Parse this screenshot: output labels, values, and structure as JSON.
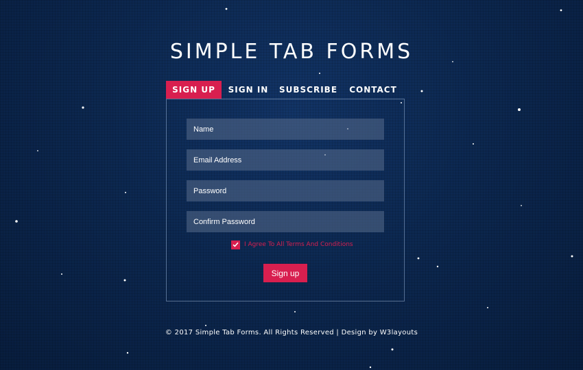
{
  "page": {
    "title": "SIMPLE TAB FORMS"
  },
  "tabs": [
    {
      "label": "SIGN UP",
      "active": true
    },
    {
      "label": "SIGN IN",
      "active": false
    },
    {
      "label": "SUBSCRIBE",
      "active": false
    },
    {
      "label": "CONTACT",
      "active": false
    }
  ],
  "form": {
    "fields": [
      {
        "placeholder": "Name",
        "value": ""
      },
      {
        "placeholder": "Email Address",
        "value": ""
      },
      {
        "placeholder": "Password",
        "value": ""
      },
      {
        "placeholder": "Confirm Password",
        "value": ""
      }
    ],
    "agree": {
      "label": "I Agree To All Terms And Conditions",
      "checked": true
    },
    "submit_label": "Sign up"
  },
  "footer": {
    "text": "© 2017 Simple Tab Forms. All Rights Reserved | Design by W3layouts"
  },
  "colors": {
    "accent": "#d81f4f",
    "background": "#0c2850",
    "field": "#4e6283"
  },
  "icons": {
    "checkbox": "check-icon"
  }
}
